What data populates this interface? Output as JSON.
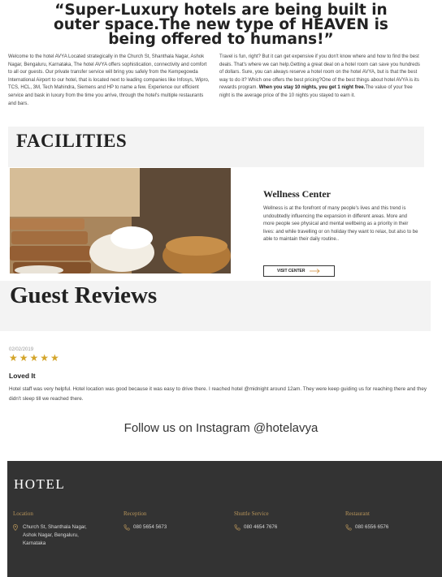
{
  "hero": {
    "title_lines": [
      "“Super-Luxury hotels are being built in",
      "outer space.The new type of HEAVEN is",
      "being offered to humans!”"
    ]
  },
  "intro": {
    "left": "Welcome to the hotel AVYA Located strategically in the Church St, Shanthala Nagar, Ashok Nagar, Bengaluru, Karnataka, The hotel AVYA offers sophistication, connectivity and comfort to all our guests. Our private transfer service will bring you safely from the Kempegowda International Airport to our hotel, that is located next to leading companies like Infosys, Wipro, TCS, HCL, 3M, Tech Mahindra, Siemens and HP to name a few. Experience our efficient service and bask in luxury from the time you arrive, through the hotel's multiple restaurants and bars.",
    "right_before": "Travel is fun, right? But it can get expensive if you don't know where and how to find the best deals. That's where we can help.Getting a great deal on a hotel room can save you hundreds of dollars. Sure, you can always reserve a hotel room on the hotel AVYA, but is that the best way to do it? Which one offers the best pricing?One of the best things about hotel AVYA is its rewards program.",
    "right_bold": "When you stay 10 nights, you get 1 night free.",
    "right_after": "The value of your free night is the average price of the 10 nights you stayed to earn it."
  },
  "facilities": {
    "title": "FACILITIES",
    "wellness_title": "Wellness Center",
    "wellness_desc": "Wellness is at the forefront of many people's lives and this trend is undoubtedly influencing the expansion in different areas. More and more people see physical and mental wellbeing as a priority in their lives: and while travelling or on holiday they want to relax, but also to be able to maintain their daily routine..",
    "button_label": "VISIT CENTER"
  },
  "reviews": {
    "title": "Guest Reviews",
    "date": "02/02/2019",
    "stars": "★★★★★",
    "rating": 5,
    "heading": "Loved It",
    "body": "Hotel staff was very helpful. Hotel location was good because it was easy to drive there. I reached hotel @midnight around 12am. They were keep guiding us for reaching there and they didn't sleep till we reached there."
  },
  "instagram": {
    "text": "Follow us on Instagram @hotelavya"
  },
  "footer": {
    "brand": "HOTEL",
    "accent_color": "#b8955a",
    "columns": [
      {
        "heading": "Location",
        "icon": "map-pin-icon",
        "lines": [
          "Church St, Shanthala Nagar,",
          "Ashok Nagar, Bengaluru,",
          "Karnataka"
        ]
      },
      {
        "heading": "Reception",
        "icon": "phone-icon",
        "lines": [
          "080 5654 5673"
        ]
      },
      {
        "heading": "Shuttle Service",
        "icon": "phone-icon",
        "lines": [
          "080 4654 7676"
        ]
      },
      {
        "heading": "Restaurant",
        "icon": "phone-icon",
        "lines": [
          "080 6556 6576"
        ]
      }
    ]
  }
}
